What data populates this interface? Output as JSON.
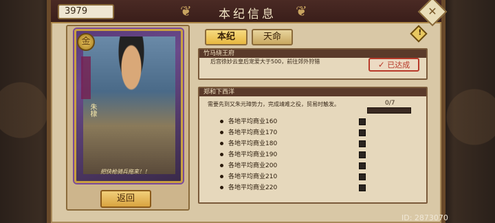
{
  "header": {
    "title": "本纪信息",
    "currency": "3979",
    "close_icon": "diamond-close-icon"
  },
  "card": {
    "medal": "金",
    "name": "朱棣",
    "caption": "把快枪骑兵拖来！！"
  },
  "back_button": "返回",
  "tabs": [
    {
      "label": "本纪",
      "active": true
    },
    {
      "label": "天命",
      "active": false
    }
  ],
  "info_icon": "!",
  "task1": {
    "title": "竹马绕王府",
    "description": "后宫徐妙云皇后宠爱大于500，前往郊外狩猎",
    "status": "已达成",
    "status_icon": "✓"
  },
  "task2": {
    "title": "郑和下西洋",
    "description": "需要先到又朱元璋势力，完成靖难之役，贸易时触发。",
    "progress_text": "0/7",
    "progress": 0,
    "requirements": [
      "各地平均商业160",
      "各地平均商业170",
      "各地平均商业180",
      "各地平均商业190",
      "各地平均商业200",
      "各地平均商业210",
      "各地平均商业220"
    ]
  },
  "footer": {
    "user_id": "ID: 2873070"
  },
  "colors": {
    "accent": "#e8b840",
    "stamp": "#b83a2a",
    "progress_track": "#3a2a22"
  }
}
